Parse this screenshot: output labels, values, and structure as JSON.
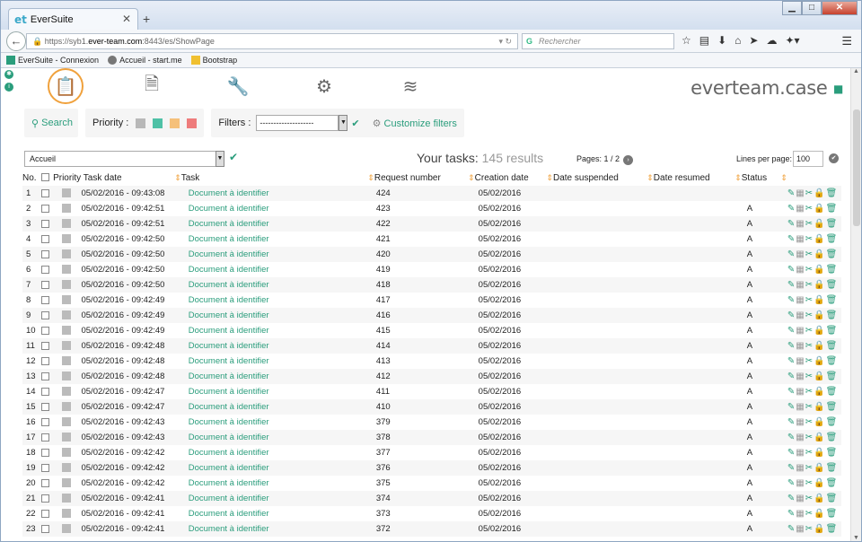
{
  "browser": {
    "tab_title": "EverSuite",
    "tab_logo": "et",
    "url_prefix": "https://syb1.",
    "url_domain": "ever-team.com",
    "url_suffix": ":8443/es/ShowPage",
    "search_placeholder": "Rechercher",
    "bookmarks": [
      "EverSuite - Connexion",
      "Accueil - start.me",
      "Bootstrap"
    ]
  },
  "app": {
    "brand": "everteam.case",
    "search_label": "Search",
    "priority_label": "Priority :",
    "priority_colors": [
      "#b8b8b8",
      "#4fc1a6",
      "#f5c07a",
      "#ee7c7c"
    ],
    "filters_label": "Filters :",
    "filters_value": "--------------------",
    "customize_label": "Customize filters",
    "queue_value": "Accueil",
    "your_tasks_label": "Your tasks:",
    "results_text": "145 results",
    "pages_text": "Pages: 1 / 2",
    "lines_per_page_label": "Lines per page:",
    "lines_per_page_value": "100",
    "accent_color": "#2a9d7c",
    "highlight_color": "#f0a13c"
  },
  "table": {
    "headers": {
      "no": "No.",
      "priority": "Priority",
      "task_date": "Task date",
      "task": "Task",
      "request_number": "Request number",
      "creation_date": "Creation date",
      "date_suspended": "Date suspended",
      "date_resumed": "Date resumed",
      "status": "Status"
    },
    "rows": [
      {
        "no": "1",
        "date": "05/02/2016 - 09:43:08",
        "task": "Document à identifier",
        "req": "424",
        "created": "05/02/2016",
        "status": ""
      },
      {
        "no": "2",
        "date": "05/02/2016 - 09:42:51",
        "task": "Document à identifier",
        "req": "423",
        "created": "05/02/2016",
        "status": "A"
      },
      {
        "no": "3",
        "date": "05/02/2016 - 09:42:51",
        "task": "Document à identifier",
        "req": "422",
        "created": "05/02/2016",
        "status": "A"
      },
      {
        "no": "4",
        "date": "05/02/2016 - 09:42:50",
        "task": "Document à identifier",
        "req": "421",
        "created": "05/02/2016",
        "status": "A"
      },
      {
        "no": "5",
        "date": "05/02/2016 - 09:42:50",
        "task": "Document à identifier",
        "req": "420",
        "created": "05/02/2016",
        "status": "A"
      },
      {
        "no": "6",
        "date": "05/02/2016 - 09:42:50",
        "task": "Document à identifier",
        "req": "419",
        "created": "05/02/2016",
        "status": "A"
      },
      {
        "no": "7",
        "date": "05/02/2016 - 09:42:50",
        "task": "Document à identifier",
        "req": "418",
        "created": "05/02/2016",
        "status": "A"
      },
      {
        "no": "8",
        "date": "05/02/2016 - 09:42:49",
        "task": "Document à identifier",
        "req": "417",
        "created": "05/02/2016",
        "status": "A"
      },
      {
        "no": "9",
        "date": "05/02/2016 - 09:42:49",
        "task": "Document à identifier",
        "req": "416",
        "created": "05/02/2016",
        "status": "A"
      },
      {
        "no": "10",
        "date": "05/02/2016 - 09:42:49",
        "task": "Document à identifier",
        "req": "415",
        "created": "05/02/2016",
        "status": "A"
      },
      {
        "no": "11",
        "date": "05/02/2016 - 09:42:48",
        "task": "Document à identifier",
        "req": "414",
        "created": "05/02/2016",
        "status": "A"
      },
      {
        "no": "12",
        "date": "05/02/2016 - 09:42:48",
        "task": "Document à identifier",
        "req": "413",
        "created": "05/02/2016",
        "status": "A"
      },
      {
        "no": "13",
        "date": "05/02/2016 - 09:42:48",
        "task": "Document à identifier",
        "req": "412",
        "created": "05/02/2016",
        "status": "A"
      },
      {
        "no": "14",
        "date": "05/02/2016 - 09:42:47",
        "task": "Document à identifier",
        "req": "411",
        "created": "05/02/2016",
        "status": "A"
      },
      {
        "no": "15",
        "date": "05/02/2016 - 09:42:47",
        "task": "Document à identifier",
        "req": "410",
        "created": "05/02/2016",
        "status": "A"
      },
      {
        "no": "16",
        "date": "05/02/2016 - 09:42:43",
        "task": "Document à identifier",
        "req": "379",
        "created": "05/02/2016",
        "status": "A"
      },
      {
        "no": "17",
        "date": "05/02/2016 - 09:42:43",
        "task": "Document à identifier",
        "req": "378",
        "created": "05/02/2016",
        "status": "A"
      },
      {
        "no": "18",
        "date": "05/02/2016 - 09:42:42",
        "task": "Document à identifier",
        "req": "377",
        "created": "05/02/2016",
        "status": "A"
      },
      {
        "no": "19",
        "date": "05/02/2016 - 09:42:42",
        "task": "Document à identifier",
        "req": "376",
        "created": "05/02/2016",
        "status": "A"
      },
      {
        "no": "20",
        "date": "05/02/2016 - 09:42:42",
        "task": "Document à identifier",
        "req": "375",
        "created": "05/02/2016",
        "status": "A"
      },
      {
        "no": "21",
        "date": "05/02/2016 - 09:42:41",
        "task": "Document à identifier",
        "req": "374",
        "created": "05/02/2016",
        "status": "A"
      },
      {
        "no": "22",
        "date": "05/02/2016 - 09:42:41",
        "task": "Document à identifier",
        "req": "373",
        "created": "05/02/2016",
        "status": "A"
      },
      {
        "no": "23",
        "date": "05/02/2016 - 09:42:41",
        "task": "Document à identifier",
        "req": "372",
        "created": "05/02/2016",
        "status": "A"
      }
    ]
  }
}
